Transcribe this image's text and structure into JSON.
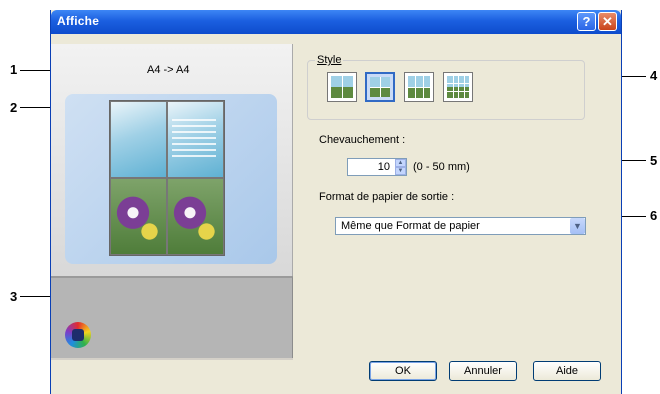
{
  "window": {
    "title": "Affiche",
    "help_btn": "?",
    "close_btn": "✕"
  },
  "preview": {
    "paper_size": "A4 -> A4"
  },
  "style": {
    "label": "Style",
    "options": [
      "style-1",
      "style-2",
      "style-3",
      "style-4"
    ],
    "selected_index": 1
  },
  "overlap": {
    "label": "Chevauchement :",
    "value": "10",
    "range": "(0 - 50 mm)"
  },
  "output_paper": {
    "label": "Format de papier de sortie :",
    "value": "Même que Format de papier"
  },
  "buttons": {
    "ok": "OK",
    "cancel": "Annuler",
    "help": "Aide"
  },
  "callouts": [
    "1",
    "2",
    "3",
    "4",
    "5",
    "6"
  ],
  "colors": {
    "titlebar": "#1b5fe0",
    "dialog_bg": "#ece9d8"
  }
}
